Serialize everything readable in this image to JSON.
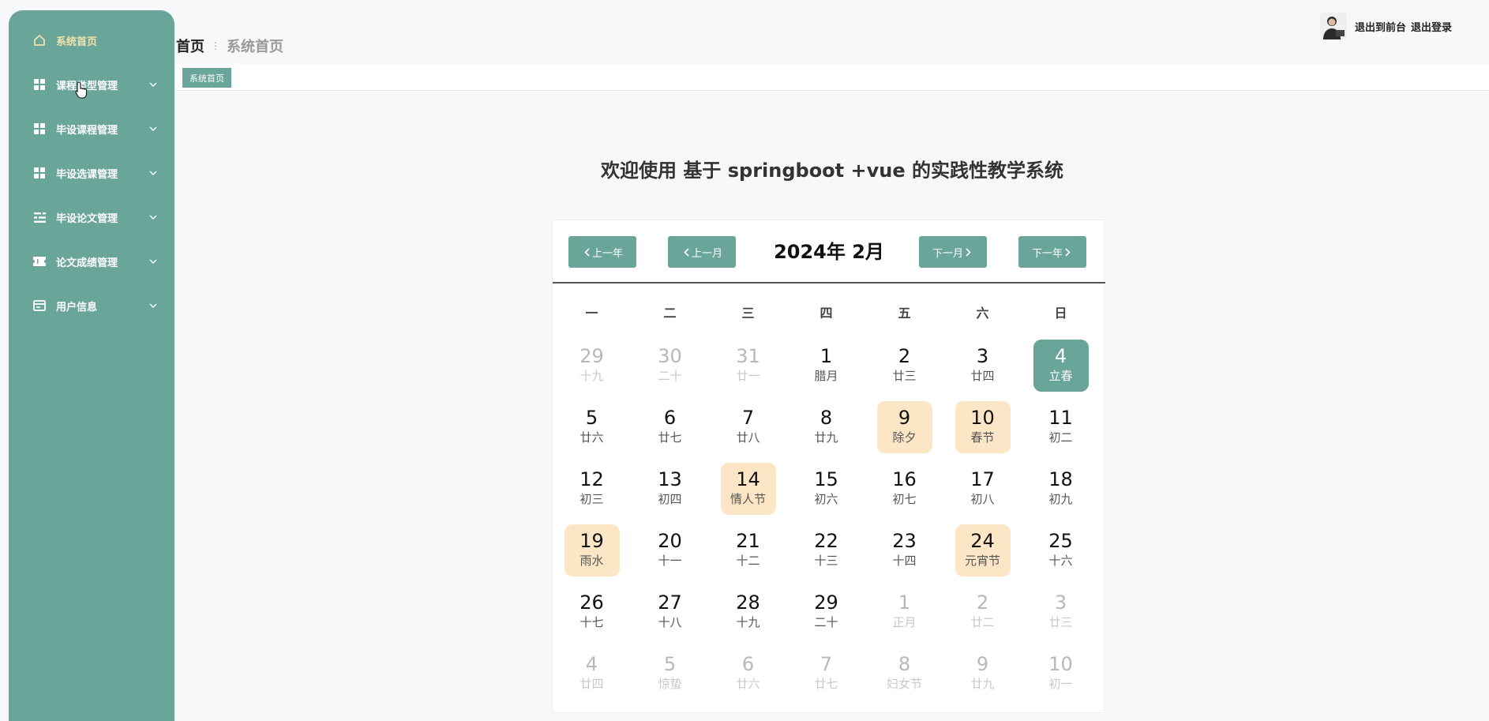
{
  "sidebar": {
    "items": [
      {
        "label": "系统首页",
        "icon": "home-icon",
        "active": true,
        "has_chevron": false
      },
      {
        "label": "课程类型管理",
        "icon": "grid-icon",
        "active": false,
        "has_chevron": true
      },
      {
        "label": "毕设课程管理",
        "icon": "grid-icon",
        "active": false,
        "has_chevron": true
      },
      {
        "label": "毕设选课管理",
        "icon": "grid-icon",
        "active": false,
        "has_chevron": true
      },
      {
        "label": "毕设论文管理",
        "icon": "sliders-icon",
        "active": false,
        "has_chevron": true
      },
      {
        "label": "论文成绩管理",
        "icon": "ticket-icon",
        "active": false,
        "has_chevron": true
      },
      {
        "label": "用户信息",
        "icon": "card-icon",
        "active": false,
        "has_chevron": true
      }
    ]
  },
  "breadcrumb": {
    "home": "首页",
    "separator": "⋮",
    "current": "系统首页"
  },
  "user": {
    "front_link": "退出到前台",
    "logout_link": "退出登录"
  },
  "tabs": [
    {
      "label": "系统首页"
    }
  ],
  "welcome": "欢迎使用 基于 springboot +vue 的实践性教学系统",
  "calendar": {
    "title": "2024年 2月",
    "prev_year": "上一年",
    "prev_month": "上一月",
    "next_month": "下一月",
    "next_year": "下一年",
    "weekdays": [
      "一",
      "二",
      "三",
      "四",
      "五",
      "六",
      "日"
    ],
    "days": [
      {
        "num": "29",
        "lunar": "十九",
        "type": "other"
      },
      {
        "num": "30",
        "lunar": "二十",
        "type": "other"
      },
      {
        "num": "31",
        "lunar": "廿一",
        "type": "other"
      },
      {
        "num": "1",
        "lunar": "腊月",
        "type": "normal"
      },
      {
        "num": "2",
        "lunar": "廿三",
        "type": "normal"
      },
      {
        "num": "3",
        "lunar": "廿四",
        "type": "normal"
      },
      {
        "num": "4",
        "lunar": "立春",
        "type": "today"
      },
      {
        "num": "5",
        "lunar": "廿六",
        "type": "normal"
      },
      {
        "num": "6",
        "lunar": "廿七",
        "type": "normal"
      },
      {
        "num": "7",
        "lunar": "廿八",
        "type": "normal"
      },
      {
        "num": "8",
        "lunar": "廿九",
        "type": "normal"
      },
      {
        "num": "9",
        "lunar": "除夕",
        "type": "festival"
      },
      {
        "num": "10",
        "lunar": "春节",
        "type": "festival"
      },
      {
        "num": "11",
        "lunar": "初二",
        "type": "normal"
      },
      {
        "num": "12",
        "lunar": "初三",
        "type": "normal"
      },
      {
        "num": "13",
        "lunar": "初四",
        "type": "normal"
      },
      {
        "num": "14",
        "lunar": "情人节",
        "type": "festival"
      },
      {
        "num": "15",
        "lunar": "初六",
        "type": "normal"
      },
      {
        "num": "16",
        "lunar": "初七",
        "type": "normal"
      },
      {
        "num": "17",
        "lunar": "初八",
        "type": "normal"
      },
      {
        "num": "18",
        "lunar": "初九",
        "type": "normal"
      },
      {
        "num": "19",
        "lunar": "雨水",
        "type": "festival"
      },
      {
        "num": "20",
        "lunar": "十一",
        "type": "normal"
      },
      {
        "num": "21",
        "lunar": "十二",
        "type": "normal"
      },
      {
        "num": "22",
        "lunar": "十三",
        "type": "normal"
      },
      {
        "num": "23",
        "lunar": "十四",
        "type": "normal"
      },
      {
        "num": "24",
        "lunar": "元宵节",
        "type": "festival"
      },
      {
        "num": "25",
        "lunar": "十六",
        "type": "normal"
      },
      {
        "num": "26",
        "lunar": "十七",
        "type": "normal"
      },
      {
        "num": "27",
        "lunar": "十八",
        "type": "normal"
      },
      {
        "num": "28",
        "lunar": "十九",
        "type": "normal"
      },
      {
        "num": "29",
        "lunar": "二十",
        "type": "normal"
      },
      {
        "num": "1",
        "lunar": "正月",
        "type": "other"
      },
      {
        "num": "2",
        "lunar": "廿二",
        "type": "other"
      },
      {
        "num": "3",
        "lunar": "廿三",
        "type": "other"
      },
      {
        "num": "4",
        "lunar": "廿四",
        "type": "other"
      },
      {
        "num": "5",
        "lunar": "惊蛰",
        "type": "other"
      },
      {
        "num": "6",
        "lunar": "廿六",
        "type": "other"
      },
      {
        "num": "7",
        "lunar": "廿七",
        "type": "other"
      },
      {
        "num": "8",
        "lunar": "妇女节",
        "type": "other"
      },
      {
        "num": "9",
        "lunar": "廿九",
        "type": "other"
      },
      {
        "num": "10",
        "lunar": "初一",
        "type": "other"
      }
    ]
  },
  "colors": {
    "accent": "#6aa59a",
    "festival": "#fde6c6",
    "active_label": "#f4e3a8"
  }
}
